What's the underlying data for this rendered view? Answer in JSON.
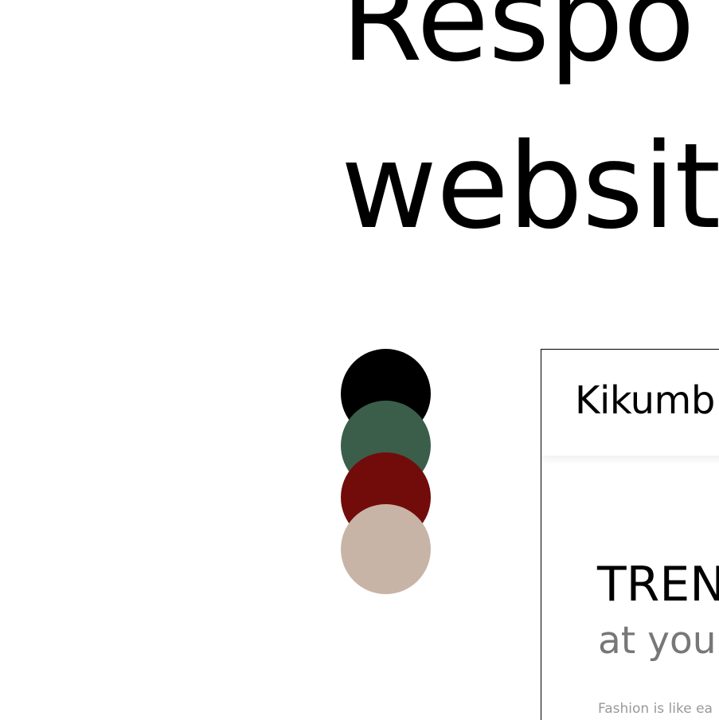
{
  "hero": {
    "line1": "Respo",
    "line2": "websit"
  },
  "palette": {
    "swatches": [
      {
        "name": "black-swatch",
        "color": "#000000"
      },
      {
        "name": "dark-green-swatch",
        "color": "#3b5e4b"
      },
      {
        "name": "dark-red-swatch",
        "color": "#720c0b"
      },
      {
        "name": "beige-swatch",
        "color": "#c8b4a6"
      }
    ]
  },
  "preview": {
    "brand": "Kikumb",
    "title": "TREN",
    "subtitle": "at you",
    "body": "Fashion is like ea"
  }
}
